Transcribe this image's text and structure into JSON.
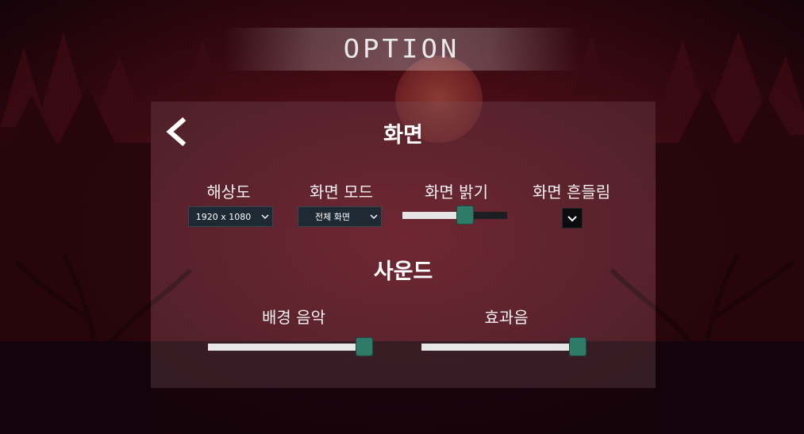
{
  "title": "OPTION",
  "screen_section": {
    "title": "화면",
    "resolution": {
      "label": "해상도",
      "value": "1920 x 1080"
    },
    "screen_mode": {
      "label": "화면 모드",
      "value": "전체 화면"
    },
    "brightness": {
      "label": "화면 밝기",
      "level": 0.62
    },
    "screen_shake": {
      "label": "화면 흔들림",
      "checked": true
    }
  },
  "sound_section": {
    "title": "사운드",
    "bgm": {
      "label": "배경 음악",
      "level": 1.0
    },
    "sfx": {
      "label": "효과음",
      "level": 1.0
    }
  },
  "colors": {
    "slider_knob": "#2f7b6a",
    "slider_fill": "#e6e6e6",
    "panel": "#78505a",
    "background": "#4a0d17"
  }
}
